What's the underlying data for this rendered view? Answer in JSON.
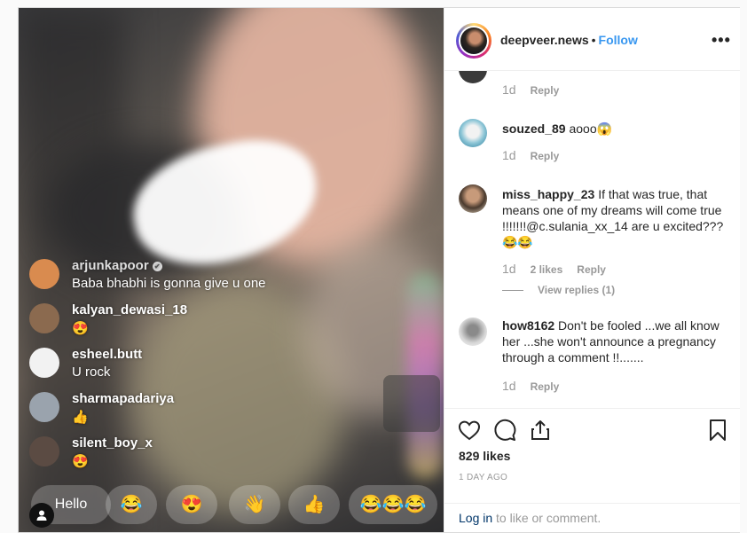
{
  "header": {
    "username": "deepveer.news",
    "separator": "•",
    "follow_label": "Follow",
    "more_label": "•••"
  },
  "live": {
    "comments": [
      {
        "user": "arjunkapoor",
        "verified": true,
        "text": "Baba bhabhi is gonna give u one"
      },
      {
        "user": "kalyan_dewasi_18",
        "verified": false,
        "text": "😍"
      },
      {
        "user": "esheel.butt",
        "verified": false,
        "text": "U rock"
      },
      {
        "user": "sharmapadariya",
        "verified": false,
        "text": "👍"
      },
      {
        "user": "silent_boy_x",
        "verified": false,
        "text": "😍"
      }
    ],
    "hello_label": "Hello",
    "reactions": [
      "😂",
      "😍",
      "👋",
      "👍",
      "😂😂😂"
    ]
  },
  "comments": [
    {
      "age": "1d",
      "reply": "Reply"
    },
    {
      "user": "souzed_89",
      "text": "aooo😱",
      "age": "1d",
      "reply": "Reply"
    },
    {
      "user": "miss_happy_23",
      "text": "If that was true, that means one of my dreams will come true !!!!!!!@c.sulania_xx_14 are u excited??? 😂😂",
      "age": "1d",
      "likes": "2 likes",
      "reply": "Reply",
      "view_replies": "View replies (1)"
    },
    {
      "user": "how8162",
      "text": "Don't be fooled ...we all know her ...she won't announce a pregnancy through a comment !!.......",
      "age": "1d",
      "reply": "Reply"
    }
  ],
  "actions": {
    "likes": "829 likes",
    "post_age": "1 DAY AGO"
  },
  "login": {
    "link": "Log in",
    "rest": " to like or comment."
  },
  "colors": {
    "follow": "#3897f0",
    "text": "#262626",
    "muted": "#999999",
    "border": "#dbdbdb"
  }
}
